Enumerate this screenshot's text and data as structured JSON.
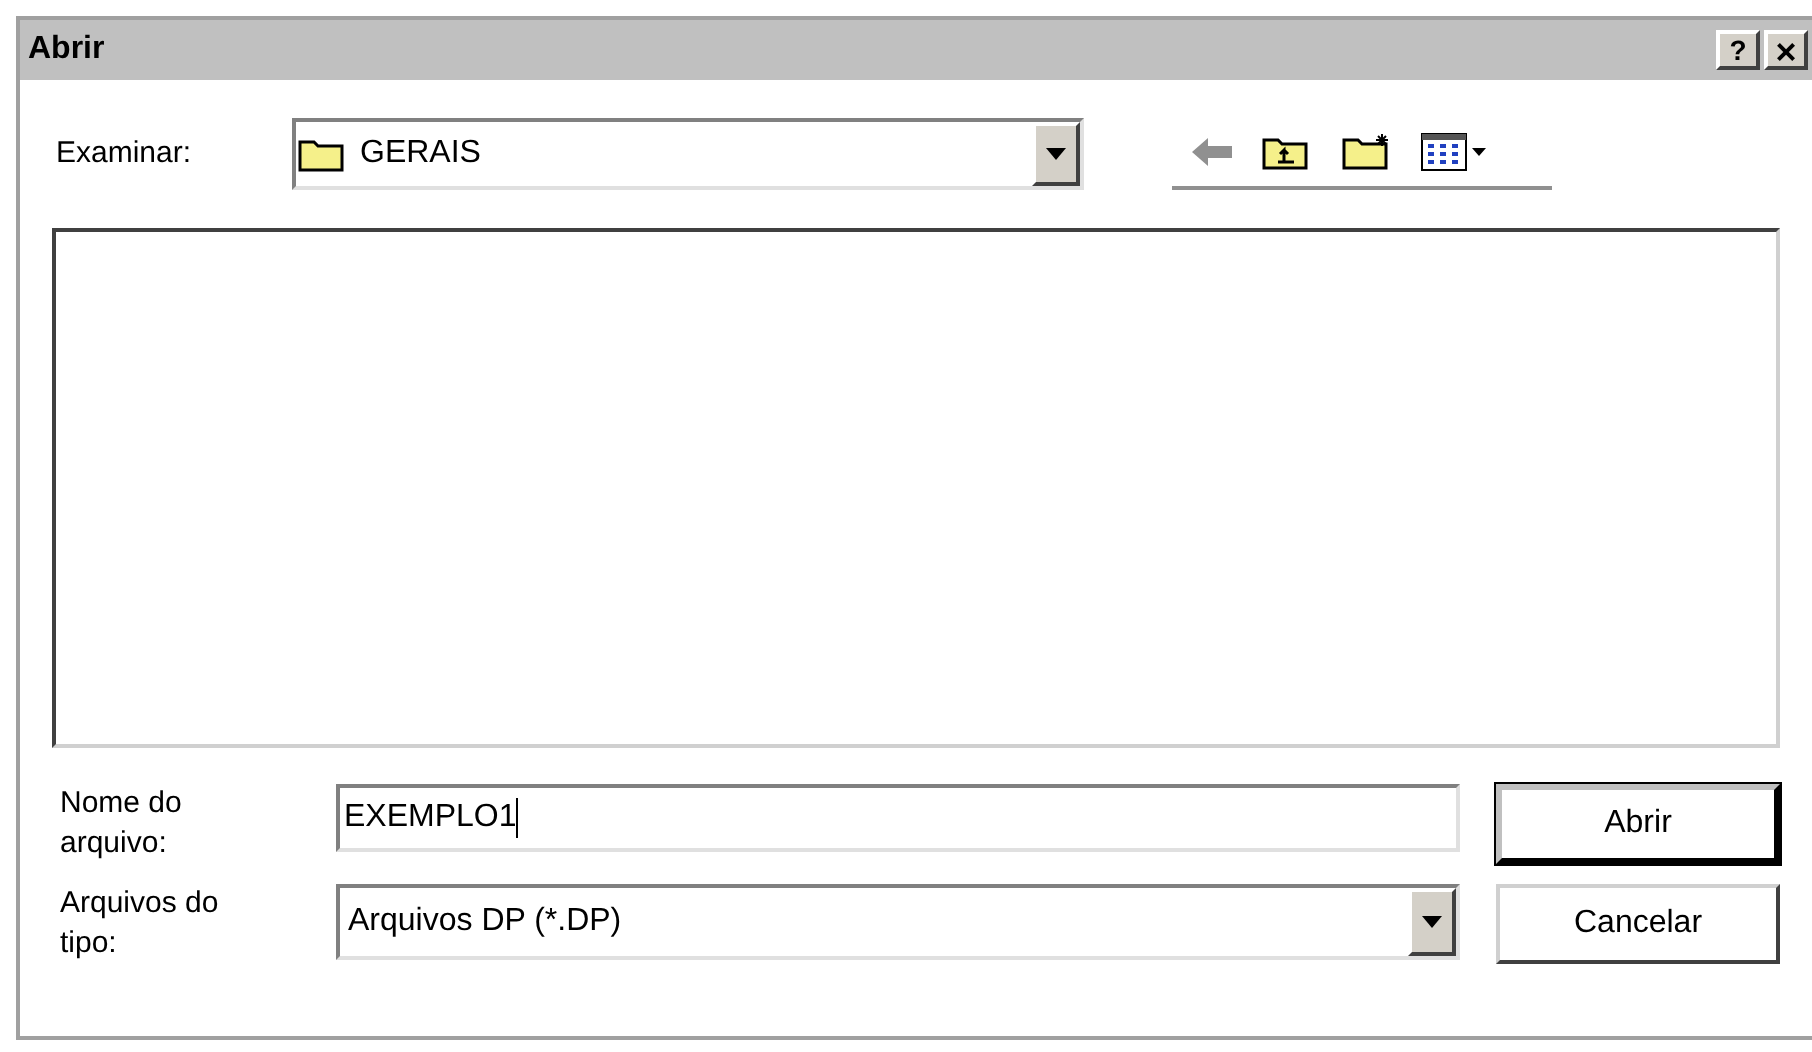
{
  "window": {
    "title": "Abrir",
    "help_button": "?",
    "close_button": "×"
  },
  "look_in": {
    "label": "Examinar:",
    "value": "GERAIS"
  },
  "back_disabled": true,
  "file_name": {
    "label_line1": "Nome do",
    "label_line2": "arquivo:",
    "value": "EXEMPLO1"
  },
  "file_type": {
    "label_line1": "Arquivos do",
    "label_line2": "tipo:",
    "value": "Arquivos DP (*.DP)"
  },
  "buttons": [
    {
      "label": "Abrir",
      "kind": "default"
    },
    {
      "label": "Cancelar",
      "kind": "normal"
    }
  ]
}
